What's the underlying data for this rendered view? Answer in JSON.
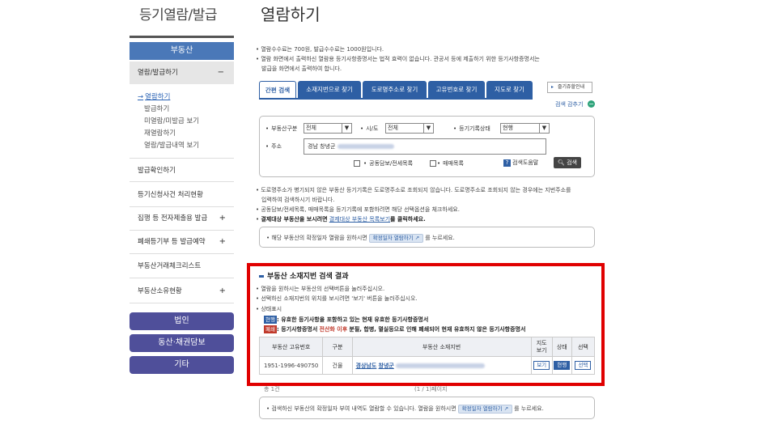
{
  "sidebar": {
    "title": "등기열람/발급",
    "category": "부동산",
    "open_menu": "열람/발급하기",
    "sub_items": [
      "열람하기",
      "발급하기",
      "미열람/미발급 보기",
      "재열람하기",
      "열람/발급내역 보기"
    ],
    "menus": [
      "발급확인하기",
      "등기신청사건 처리현황",
      "집행 등 전자제출용 발급",
      "폐쇄등기부 등 발급예약",
      "부동산거래체크리스트",
      "부동산소유현황"
    ],
    "pills": [
      "법인",
      "동산·채권담보",
      "기타"
    ]
  },
  "main": {
    "title": "열람하기",
    "notes": [
      "열람수수료는 700원, 발급수수료는 1000원입니다.",
      "열람 화면에서 출력하신 열람용 등기사항증명서는 법적 효력이 없습니다. 관공서 등에 제출하기 위한 등기사항증명서는",
      "발급을 화면에서 출력하여 합니다."
    ],
    "tabs": [
      "간편 검색",
      "소재지번으로 찾기",
      "도로명주소로 찾기",
      "고유번호로 찾기",
      "지도로 찾기"
    ],
    "help_button": "즐기쥬할인내",
    "collapse_link": "검색 감추기"
  },
  "search": {
    "type_label": "부동산구분",
    "type_value": "전체",
    "region_label": "시/도",
    "region_value": "전체",
    "status_label": "등기기록상태",
    "status_value": "현행",
    "address_label": "주소",
    "address_value": "경남 창녕군",
    "checkbox1": "공동담보/전세목록",
    "checkbox2": "매매목록",
    "guide_button": "검색도움말",
    "search_button": "검색"
  },
  "info1": {
    "line1": "도로명주소가 병기되지 않은 부동산 등기기록은 도로명주소로 조회되지 않습니다. 도로명주소로 조회되지 않는 경우에는 지번주소를",
    "line2": "입력하여 검색하시기 바랍니다.",
    "line3": "공동담보/전세목록, 매매목록을 등기기록에 포함하려면 해당 선택옵션을 체크하세요.",
    "line4_pre": "결제대상 부동산을 보시려면",
    "line4_link": "결제대상 부동산 목록보기",
    "line4_post": "를 클릭하세요."
  },
  "info2": {
    "pre": "해당 부동산의 확정일자 열람을 원하시면",
    "button": "확정일자 열람하기",
    "post": "를 누르세요."
  },
  "result": {
    "title": "부동산 소재지번 검색 결과",
    "notes": [
      "열람을 원하시는 부동산의 선택버튼을 눌러주십시오.",
      "선택하신 소재지번의 위치를 보시려면 '보기' 버튼을 눌러주십시오.",
      "상태표시"
    ],
    "status1_badge": "현행",
    "status1_text": ": 유효한 등기사항을 포함하고 있는 현재 유효한 등기사항증명서",
    "status2_badge": "폐쇄",
    "status2_pre": ": 등기사항증명서",
    "status2_em": "전산화 이후",
    "status2_post": "분필, 합병, 멸실등으로 인해 폐쇄되어 현재 유효하지 않은 등기사항증명서",
    "columns": [
      "부동산 고유번호",
      "구분",
      "부동산 소재지번",
      "지도\n보기",
      "상태",
      "선택"
    ],
    "row": {
      "id": "1951-1996-490750",
      "kind": "건물",
      "address_a": "경상남도",
      "address_b": "창녕군",
      "map": "보기",
      "state": "현행",
      "select": "선택"
    }
  },
  "paging": "(1 / 1)페이지",
  "paging_prefix": "총 1건",
  "info3": {
    "pre": "검색하신 부동산의 확정일자 부여 내역도 열람할 수 있습니다. 열람을 원하시면",
    "button": "확정일자 열람하기",
    "post": "를 누르세요."
  },
  "colors": {
    "accent": "#2e5fa4",
    "highlight": "#e00000",
    "pill": "#4f4f9a"
  }
}
